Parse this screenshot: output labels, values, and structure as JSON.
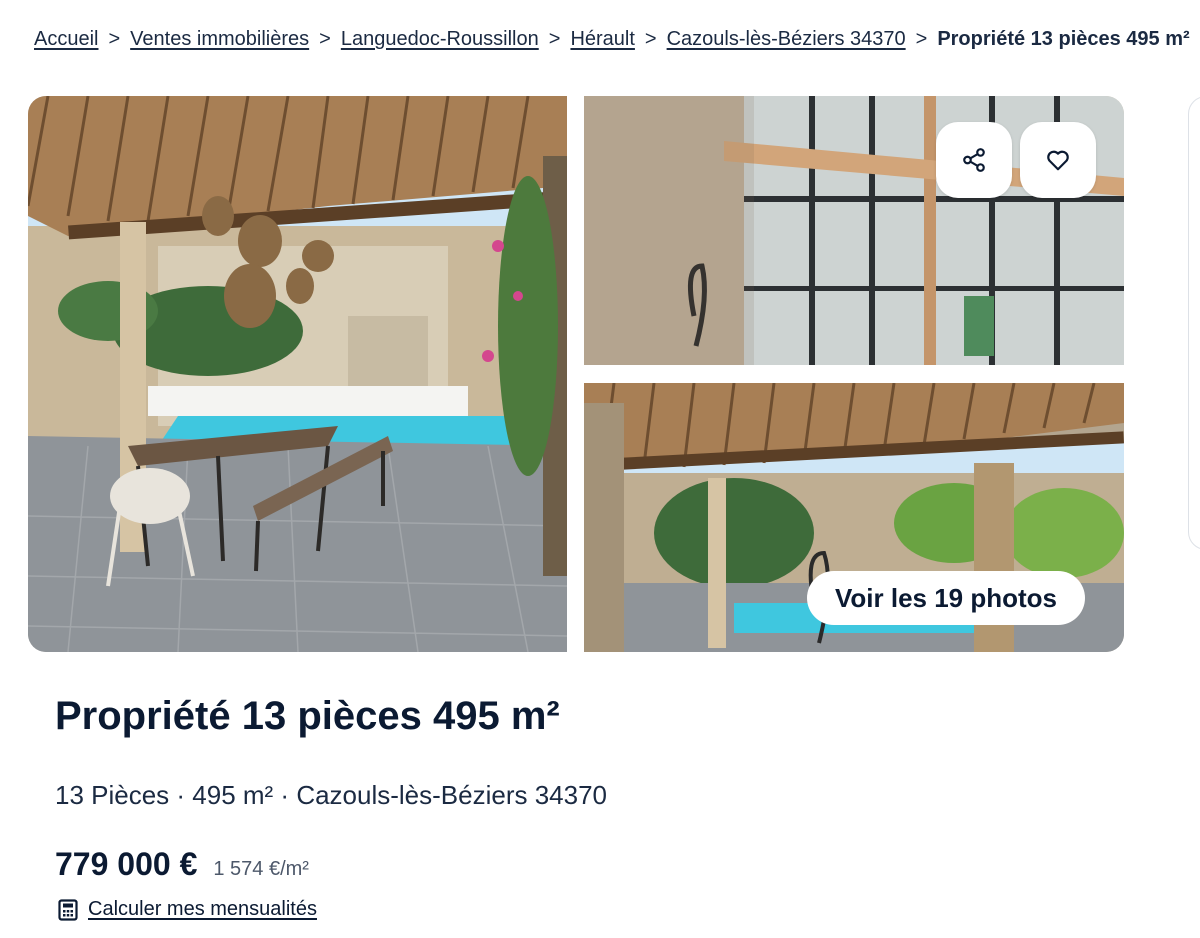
{
  "breadcrumb": {
    "items": [
      "Accueil",
      "Ventes immobilières",
      "Languedoc-Roussillon",
      "Hérault",
      "Cazouls-lès-Béziers 34370"
    ],
    "separator": ">",
    "current": "Propriété 13 pièces 495 m²"
  },
  "gallery": {
    "photos_button_label": "Voir les 19 photos",
    "share_icon": "share-icon",
    "favorite_icon": "heart-icon"
  },
  "listing": {
    "title": "Propriété 13 pièces 495 m²",
    "subtitle": "13 Pièces · 495 m² · Cazouls-lès-Béziers 34370",
    "price": "779 000 €",
    "price_per_m2": "1 574 €/m²",
    "calc_label": "Calculer mes mensualités",
    "calc_icon": "calculator-icon"
  },
  "colors": {
    "text": "#0b1a32",
    "pool": "#3fc7df",
    "wood": "#b98a5a"
  }
}
